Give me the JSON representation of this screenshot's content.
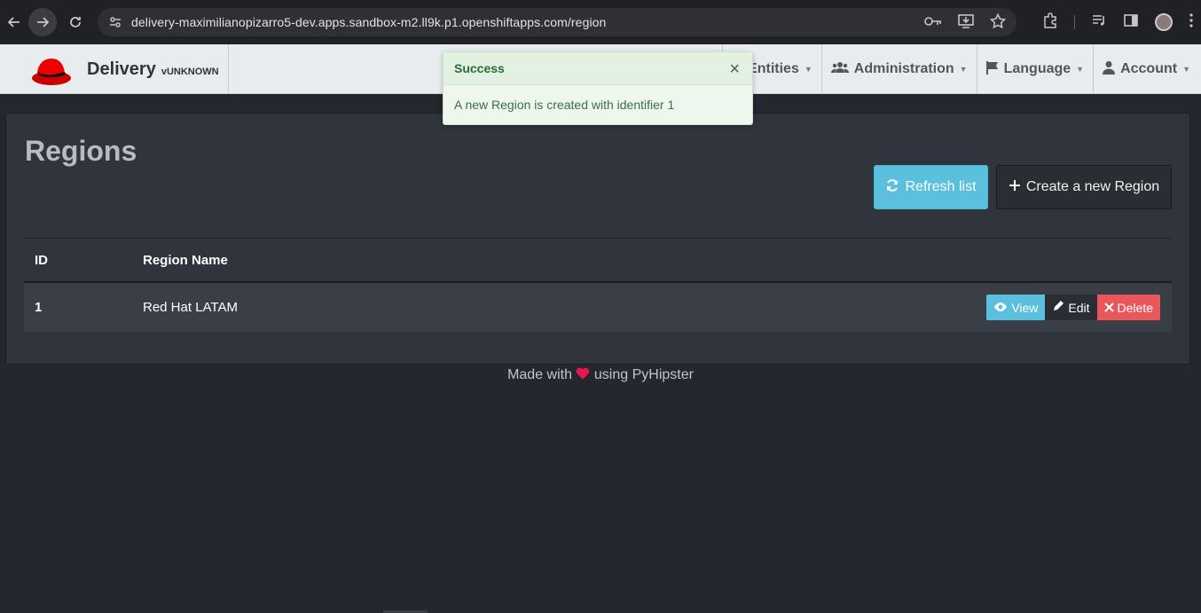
{
  "browser": {
    "url": "delivery-maximilianopizarro5-dev.apps.sandbox-m2.ll9k.p1.openshiftapps.com/region",
    "icons": [
      "back-icon",
      "forward-icon",
      "reload-icon",
      "site-settings-icon",
      "key-icon",
      "install-icon",
      "star-icon",
      "extensions-icon",
      "media-icon",
      "sidepanel-icon",
      "profile-avatar",
      "menu-icon"
    ]
  },
  "navbar": {
    "brand": "Delivery",
    "version": "vUNKNOWN",
    "items": [
      {
        "label": "Entities",
        "icon": "list-icon"
      },
      {
        "label": "Administration",
        "icon": "users-icon"
      },
      {
        "label": "Language",
        "icon": "flag-icon"
      },
      {
        "label": "Account",
        "icon": "user-icon"
      }
    ]
  },
  "toast": {
    "title": "Success",
    "message": "A new Region is created with identifier 1",
    "close": "×"
  },
  "page": {
    "title": "Regions",
    "refresh_label": "Refresh list",
    "create_label": "Create a new Region"
  },
  "table": {
    "headers": [
      "ID",
      "Region Name"
    ],
    "rows": [
      {
        "id": "1",
        "name": "Red Hat LATAM"
      }
    ],
    "actions": {
      "view": "View",
      "edit": "Edit",
      "delete": "Delete"
    }
  },
  "footer": {
    "before": "Made with",
    "after": "using PyHipster"
  },
  "colors": {
    "accent_info": "#5bc0de",
    "danger": "#e9575a",
    "success_bg": "#eef7ee",
    "heart": "#e8174f"
  }
}
